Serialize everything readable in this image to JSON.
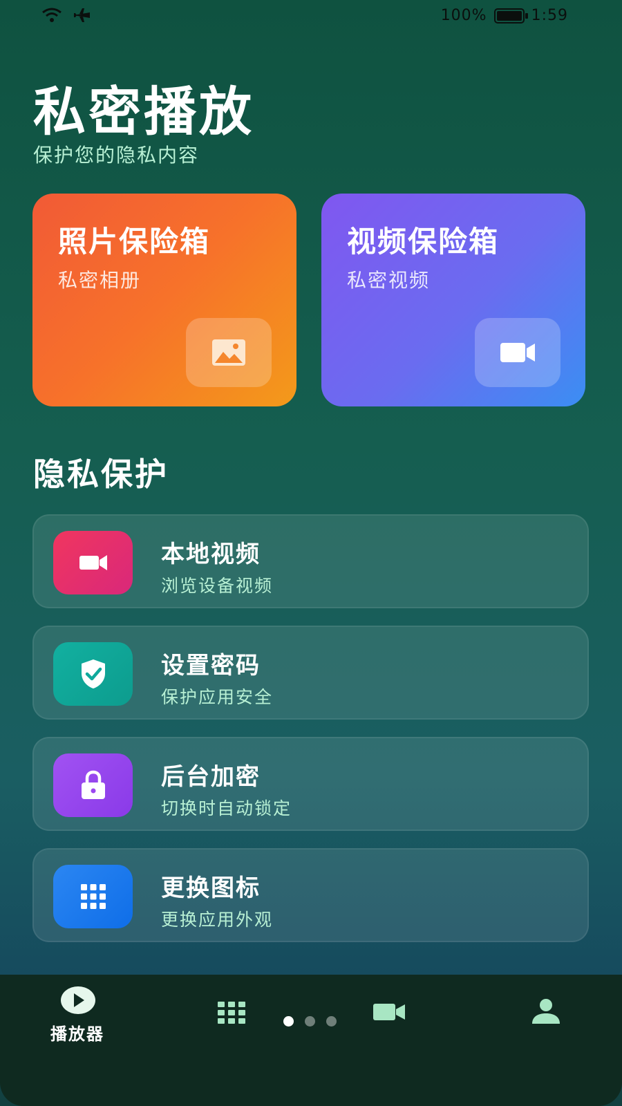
{
  "status_bar": {
    "battery": "100%",
    "time": "1:59"
  },
  "header": {
    "title": "私密播放",
    "subtitle": "保护您的隐私内容"
  },
  "vaults": [
    {
      "title": "照片保险箱",
      "subtitle": "私密相册",
      "icon": "image-icon"
    },
    {
      "title": "视频保险箱",
      "subtitle": "私密视频",
      "icon": "video-camera-icon"
    }
  ],
  "section": {
    "title": "隐私保护",
    "items": [
      {
        "title": "本地视频",
        "subtitle": "浏览设备视频",
        "icon": "video-camera-icon",
        "color": "#e8315f"
      },
      {
        "title": "设置密码",
        "subtitle": "保护应用安全",
        "icon": "shield-check-icon",
        "color": "#0fa99c"
      },
      {
        "title": "后台加密",
        "subtitle": "切换时自动锁定",
        "icon": "lock-icon",
        "color": "#9b47f0"
      },
      {
        "title": "更换图标",
        "subtitle": "更换应用外观",
        "icon": "grid-icon",
        "color": "#1a7df0"
      }
    ]
  },
  "bottom_nav": {
    "items": [
      {
        "label": "播放器",
        "icon": "play-circle-icon",
        "active": true
      },
      {
        "label": "",
        "icon": "grid-icon",
        "active": false
      },
      {
        "label": "",
        "icon": "video-camera-icon",
        "active": false
      },
      {
        "label": "",
        "icon": "person-icon",
        "active": false
      }
    ],
    "page_dots": 3,
    "active_dot": 0
  },
  "colors": {
    "accent_text": "#b8f0d4",
    "nav_icon": "#a8e6c3",
    "nav_bg": "#0f2a20"
  }
}
